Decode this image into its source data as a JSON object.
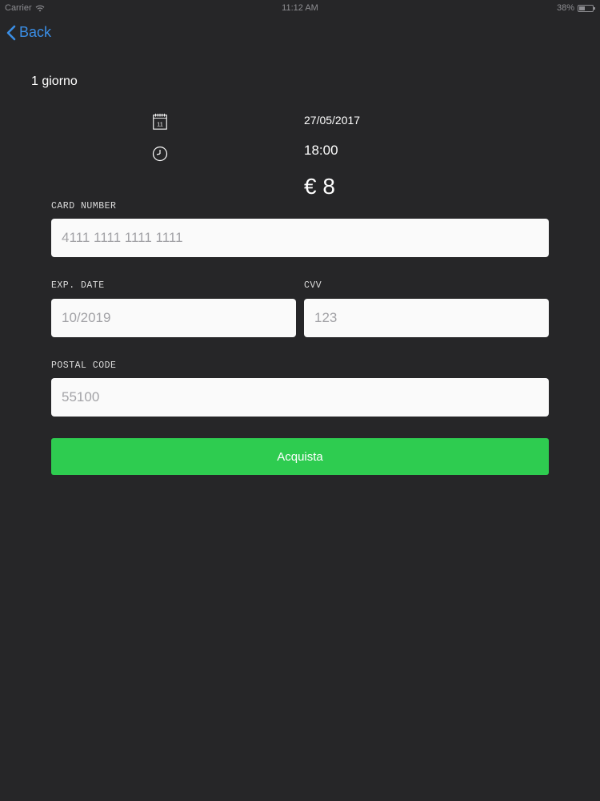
{
  "status_bar": {
    "carrier": "Carrier",
    "time": "11:12 AM",
    "battery": "38%"
  },
  "nav": {
    "back_label": "Back"
  },
  "ticket": {
    "title": "1 giorno",
    "date": "27/05/2017",
    "time": "18:00",
    "price": "€ 8",
    "calendar_day": "11"
  },
  "form": {
    "card_number": {
      "label": "CARD NUMBER",
      "placeholder": "4111 1111 1111 1111"
    },
    "exp_date": {
      "label": "EXP. DATE",
      "placeholder": "10/2019"
    },
    "cvv": {
      "label": "CVV",
      "placeholder": "123"
    },
    "postal_code": {
      "label": "POSTAL CODE",
      "placeholder": "55100"
    },
    "submit_label": "Acquista"
  },
  "colors": {
    "background": "#262628",
    "accent_back": "#3a8ee6",
    "button_green": "#2ecc50"
  },
  "icons": {
    "calendar": "calendar-icon",
    "clock": "clock-icon",
    "back": "chevron-left-icon",
    "wifi": "wifi-icon",
    "battery": "battery-icon"
  }
}
